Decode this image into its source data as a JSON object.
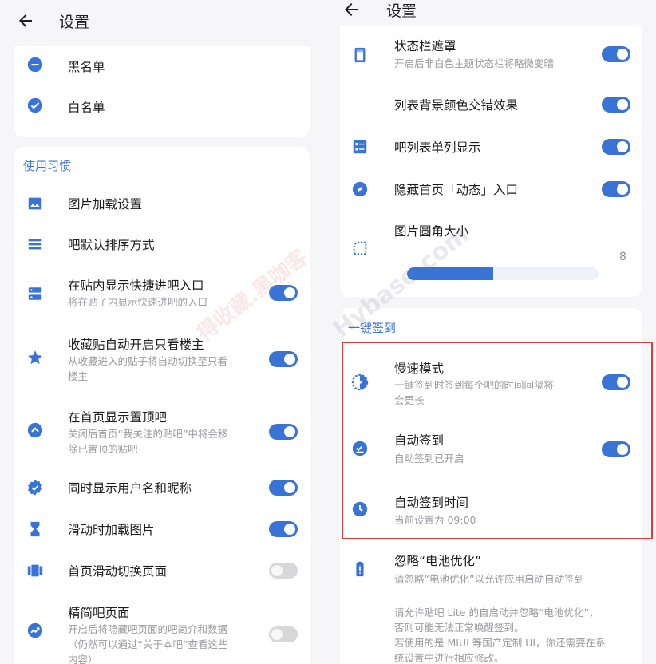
{
  "colors": {
    "accent": "#3a73d6",
    "highlight": "#e53935"
  },
  "left": {
    "title": "设置",
    "back_icon": "arrow-left-icon",
    "list_card": [
      {
        "label": "黑名单",
        "icon": "minus-circle-icon"
      },
      {
        "label": "白名单",
        "icon": "check-circle-icon"
      }
    ],
    "section_usage": "使用习惯",
    "items": [
      {
        "label": "图片加载设置",
        "icon": "image-icon"
      },
      {
        "label": "吧默认排序方式",
        "icon": "list-lines-icon"
      },
      {
        "label": "在贴内显示快捷进吧入口",
        "sub": "将在贴子内显示快速进吧的入口",
        "icon": "storage-icon",
        "toggle": true
      },
      {
        "label": "收藏贴自动开启只看楼主",
        "sub1": "从收藏进入的贴子将自动切换至只看",
        "sub2": "楼主",
        "icon": "star-icon",
        "toggle": true
      },
      {
        "label": "在首页显示置顶吧",
        "sub1": "关闭后首页“我关注的贴吧”中将会移",
        "sub2": "除已置顶的贴吧",
        "icon": "chevron-up-circle-icon",
        "toggle": true
      },
      {
        "label": "同时显示用户名和昵称",
        "icon": "verified-badge-icon",
        "toggle": true
      },
      {
        "label": "滑动时加载图片",
        "icon": "hourglass-icon",
        "toggle": true
      },
      {
        "label": "首页滑动切换页面",
        "icon": "view-carousel-icon",
        "toggle": false
      },
      {
        "label": "精简吧页面",
        "sub1": "开启后将隐藏吧页面的吧简介和数据",
        "sub2": "（仍然可以通过“关于本吧”查看这些",
        "sub3": "内容）",
        "icon": "trending-icon",
        "toggle": false
      }
    ],
    "watermark": "得收藏.黑咖客"
  },
  "right": {
    "title": "设置",
    "back_icon": "arrow-left-icon",
    "items": [
      {
        "label": "状态栏遮罩",
        "sub": "开启后非白色主题状态栏将略微变暗",
        "icon": "phone-frame-icon",
        "toggle": true
      },
      {
        "label": "列表背景颜色交错效果",
        "toggle": true
      },
      {
        "label": "吧列表单列显示",
        "icon": "list-view-icon",
        "toggle": true
      },
      {
        "label": "隐藏首页「动态」入口",
        "icon": "compass-icon",
        "toggle": true
      },
      {
        "label": "图片圆角大小",
        "icon": "rounded-corner-icon",
        "value": "8",
        "progress": 0.45
      }
    ],
    "section_sign": "一键签到",
    "sign_items": [
      {
        "label": "慢速模式",
        "sub1": "一键签到时签到每个吧的时间间隔将",
        "sub2": "会更长",
        "icon": "slow-motion-icon",
        "toggle": true
      },
      {
        "label": "自动签到",
        "sub": "自动签到已开启",
        "icon": "event-check-icon",
        "toggle": true
      },
      {
        "label": "自动签到时间",
        "sub": "当前设置为 09:00",
        "icon": "clock-icon"
      }
    ],
    "battery": {
      "label": "忽略“电池优化”",
      "sub": "请忽略“电池优化”以允许应用启动自动签到",
      "icon": "battery-alert-icon",
      "note1": "请允许贴吧 Lite 的自启动并忽略“电池优化”，",
      "note2": "否则可能无法正常唤醒签到。",
      "note3": "若使用的是 MIUI 等国产定制 UI，你还需要在系",
      "note4": "统设置中进行相应修改。"
    },
    "watermark": "Hybase.com"
  }
}
